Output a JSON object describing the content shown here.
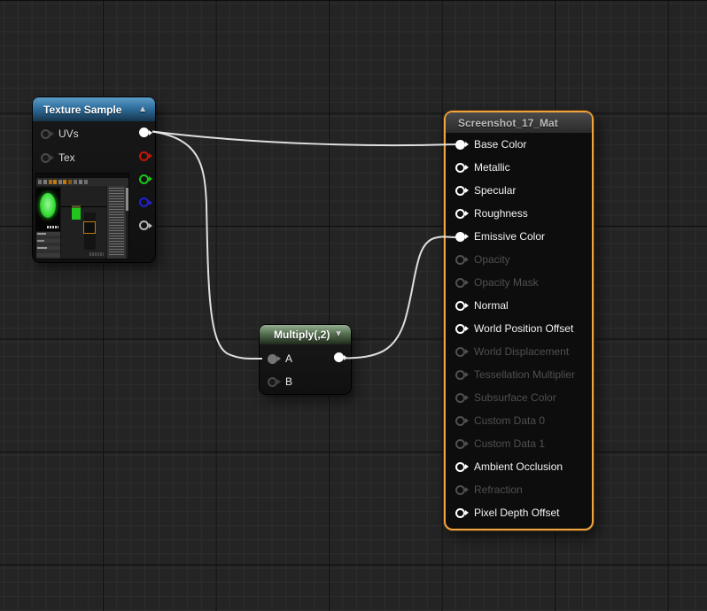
{
  "canvas": {
    "background": "#242424",
    "grid_minor": "#2e2e2e",
    "grid_major": "#0e0e0e"
  },
  "texture_sample": {
    "title": "Texture Sample",
    "collapse_icon": "▲",
    "inputs": [
      {
        "label": "UVs"
      },
      {
        "label": "Tex"
      }
    ],
    "outputs": [
      {
        "name": "rgb",
        "color": "#ffffff",
        "filled": true,
        "connected": true
      },
      {
        "name": "r",
        "color": "#c81408",
        "filled": false
      },
      {
        "name": "g",
        "color": "#17c517",
        "filled": false
      },
      {
        "name": "b",
        "color": "#2020d8",
        "filled": false
      },
      {
        "name": "a",
        "color": "#b4b4b4",
        "filled": false
      }
    ],
    "header_color": "#2f6f9e",
    "preview": "texture-preview-thumbnail"
  },
  "multiply": {
    "title": "Multiply(,2)",
    "collapse_icon": "▼",
    "inputs": [
      {
        "label": "A",
        "connected": true
      },
      {
        "label": "B",
        "connected": false
      }
    ],
    "header_color": "#56704f"
  },
  "material": {
    "title": "Screenshot_17_Mat",
    "selected": true,
    "selection_color": "#efa43e",
    "pins": [
      {
        "label": "Base Color",
        "state": "connected"
      },
      {
        "label": "Metallic",
        "state": "enabled"
      },
      {
        "label": "Specular",
        "state": "enabled"
      },
      {
        "label": "Roughness",
        "state": "enabled"
      },
      {
        "label": "Emissive Color",
        "state": "connected"
      },
      {
        "label": "Opacity",
        "state": "disabled"
      },
      {
        "label": "Opacity Mask",
        "state": "disabled"
      },
      {
        "label": "Normal",
        "state": "enabled"
      },
      {
        "label": "World Position Offset",
        "state": "enabled"
      },
      {
        "label": "World Displacement",
        "state": "disabled"
      },
      {
        "label": "Tessellation Multiplier",
        "state": "disabled"
      },
      {
        "label": "Subsurface Color",
        "state": "disabled"
      },
      {
        "label": "Custom Data 0",
        "state": "disabled"
      },
      {
        "label": "Custom Data 1",
        "state": "disabled"
      },
      {
        "label": "Ambient Occlusion",
        "state": "enabled"
      },
      {
        "label": "Refraction",
        "state": "disabled"
      },
      {
        "label": "Pixel Depth Offset",
        "state": "enabled"
      }
    ]
  },
  "connections": [
    {
      "from": "Texture Sample.RGB",
      "to": "Screenshot_17_Mat.Base Color"
    },
    {
      "from": "Texture Sample.RGB",
      "to": "Multiply.A"
    },
    {
      "from": "Multiply.Output",
      "to": "Screenshot_17_Mat.Emissive Color"
    }
  ],
  "wire_color": "#e9e9e9"
}
